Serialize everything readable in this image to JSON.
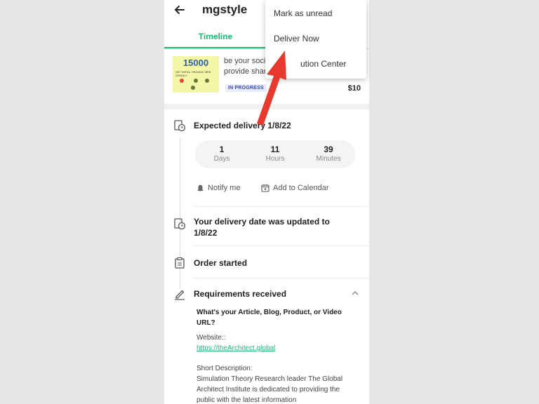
{
  "header": {
    "title": "mgstyle"
  },
  "tabs": [
    {
      "label": "Timeline"
    }
  ],
  "order": {
    "thumb_number": "15000",
    "thumb_subtitle": "GET INITIAL ORGANIC WEB SIGNALS",
    "description_line1": "be your soci",
    "description_line2": "provide shar",
    "status": "IN PROGRESS",
    "price": "$10"
  },
  "timeline": {
    "expected": "Expected delivery 1/8/22",
    "countdown": [
      {
        "value": "1",
        "label": "Days"
      },
      {
        "value": "11",
        "label": "Hours"
      },
      {
        "value": "39",
        "label": "Minutes"
      }
    ],
    "notify": "Notify me",
    "calendar": "Add to Calendar",
    "updated": "Your delivery date was updated to 1/8/22",
    "started": "Order started",
    "requirements": "Requirements received"
  },
  "requirements": {
    "question": "What's your Article, Blog, Product, or Video URL?",
    "website_label": "Website::",
    "website_url": "https://theArchitect.global",
    "short_label": "Short Description:",
    "short_text": "Simulation Theory Research leader The Global Architect Institute is dedicated to providing the public with the latest information"
  },
  "menu": {
    "items": [
      "Mark as unread",
      "Deliver Now",
      "Resolution Center"
    ],
    "partial_third": "ution Center"
  },
  "colors": {
    "accent": "#1dbf73",
    "arrow": "#e8392f"
  }
}
